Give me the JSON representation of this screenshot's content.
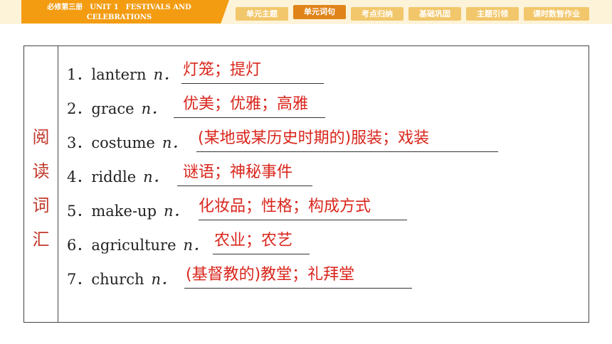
{
  "header": {
    "title_line1": "必修第三册　UNIT 1　FESTIVALS AND",
    "title_line2": "CELEBRATIONS",
    "tabs": [
      {
        "label": "单元主题"
      },
      {
        "label": "单元词句"
      },
      {
        "label": "考点归纳"
      },
      {
        "label": "基础巩固"
      },
      {
        "label": "主题引领"
      },
      {
        "label": "课时数智作业"
      }
    ]
  },
  "side_label": [
    "阅",
    "读",
    "词",
    "汇"
  ],
  "items": [
    {
      "num": "1．",
      "word": "lantern",
      "pos": "n．",
      "answer": "灯笼；提灯"
    },
    {
      "num": "2．",
      "word": "grace",
      "pos": "n．",
      "answer": "优美；优雅；高雅"
    },
    {
      "num": "3．",
      "word": "costume",
      "pos": "n．",
      "answer": "(某地或某历史时期的)服装；戏装"
    },
    {
      "num": "4．",
      "word": "riddle",
      "pos": "n．",
      "answer": "谜语；神秘事件"
    },
    {
      "num": "5．",
      "word": "make-up",
      "pos": "n．",
      "answer": "化妆品；性格；构成方式"
    },
    {
      "num": "6．",
      "word": "agriculture",
      "pos": "n．",
      "answer": "农业；农艺"
    },
    {
      "num": "7．",
      "word": "church",
      "pos": "n．",
      "answer": "(基督教的)教堂；礼拜堂"
    }
  ]
}
